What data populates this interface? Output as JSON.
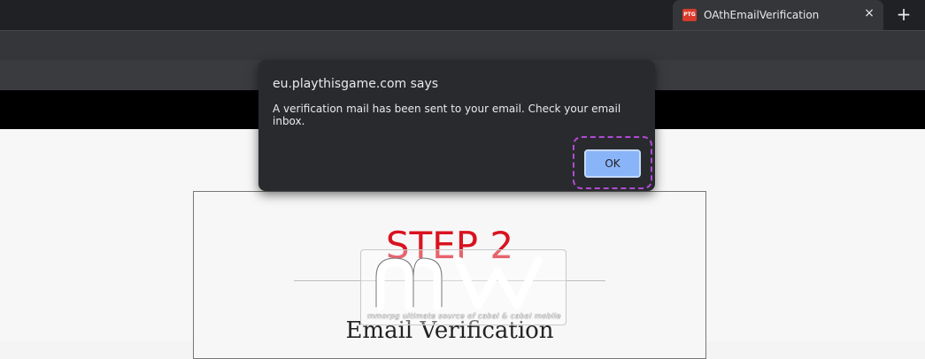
{
  "tab": {
    "title": "OAthEmailVerification",
    "favicon_label": "PTG",
    "close_glyph": "×",
    "newtab_glyph": "+"
  },
  "page": {
    "step_heading": "STEP 2",
    "section_title": "Email Verification",
    "watermark_caption": "mmorpg ultimate source of cabal & cabal mobile"
  },
  "dialog": {
    "origin": "eu.playthisgame.com says",
    "message": "A verification mail has been sent to your email. Check your email inbox.",
    "ok_label": "OK"
  },
  "colors": {
    "step_red": "#d9131f",
    "dialog_bg": "#292a2d",
    "ok_blue": "#8ab4f8",
    "focus_ring": "#b24ad6"
  },
  "icons": {
    "favicon": "ptg-favicon-icon",
    "close": "close-icon",
    "new_tab": "plus-icon"
  }
}
